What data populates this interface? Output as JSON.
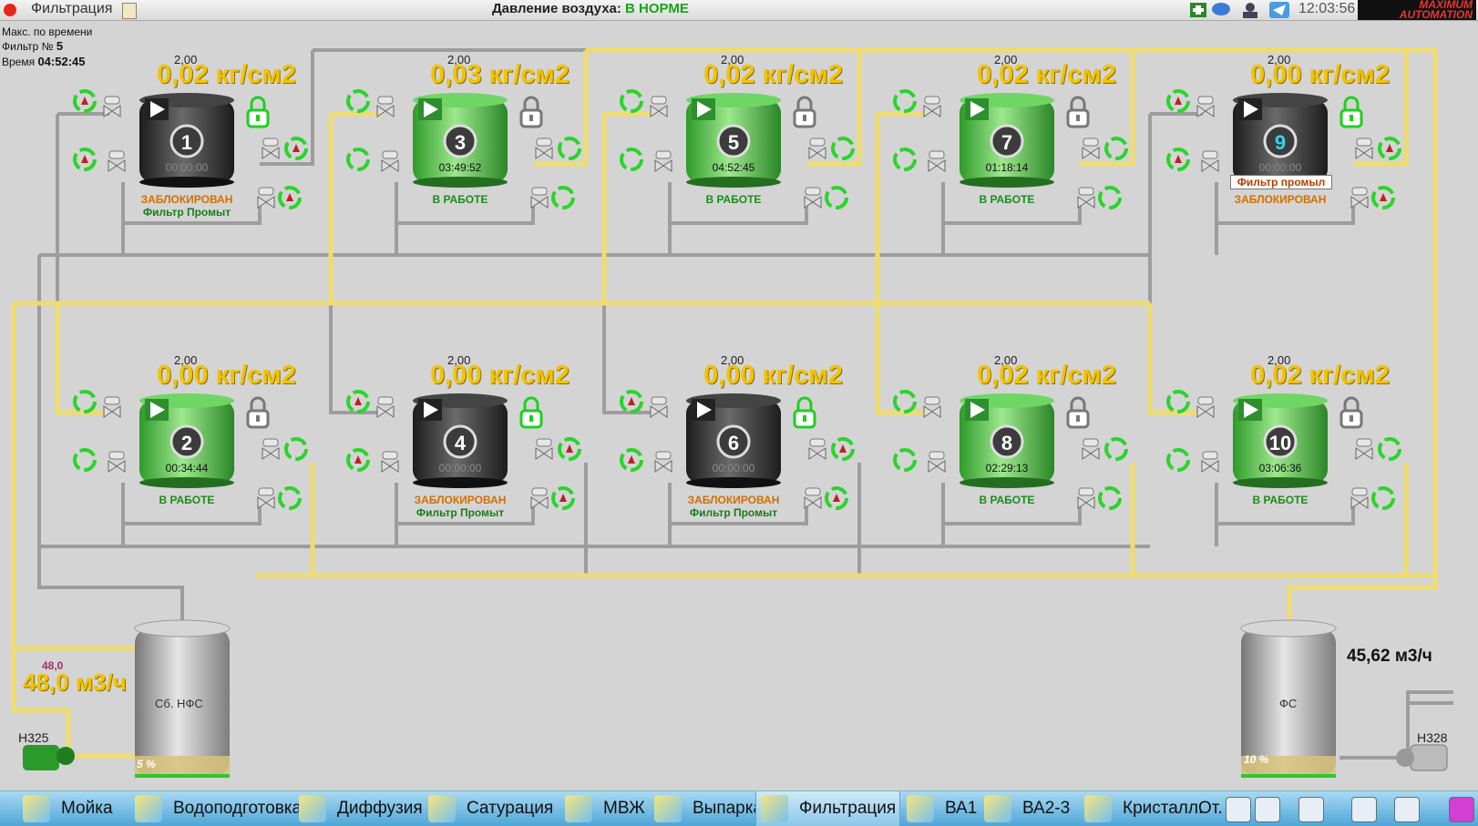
{
  "window": {
    "title": "Фильтрация",
    "air_label": "Давление воздуха:",
    "air_status": "В НОРМЕ",
    "clock": "12:03:56",
    "brand": "MAXIMUM AUTOMATION"
  },
  "info": {
    "mode": "Макс. по времени",
    "filter_label": "Фильтр №",
    "filter_no": "5",
    "time_label": "Время",
    "time": "04:52:45"
  },
  "filters": [
    {
      "id": "1",
      "set": "2,00",
      "pressure": "0,02 кг/см2",
      "timer": "00:00:00",
      "status": "ЗАБЛОКИРОВАН",
      "sub": "Фильтр Промыт",
      "state": "blocked"
    },
    {
      "id": "3",
      "set": "2,00",
      "pressure": "0,03 кг/см2",
      "timer": "03:49:52",
      "status": "В РАБОТЕ",
      "sub": "",
      "state": "work"
    },
    {
      "id": "5",
      "set": "2,00",
      "pressure": "0,02 кг/см2",
      "timer": "04:52:45",
      "status": "В РАБОТЕ",
      "sub": "",
      "state": "work"
    },
    {
      "id": "7",
      "set": "2,00",
      "pressure": "0,02 кг/см2",
      "timer": "01:18:14",
      "status": "В РАБОТЕ",
      "sub": "",
      "state": "work"
    },
    {
      "id": "9",
      "set": "2,00",
      "pressure": "0,00 кг/см2",
      "timer": "00:00:00",
      "status": "ЗАБЛОКИРОВАН",
      "sub": "Фильтр промыл",
      "state": "blocked"
    },
    {
      "id": "2",
      "set": "2,00",
      "pressure": "0,00 кг/см2",
      "timer": "00:34:44",
      "status": "В РАБОТЕ",
      "sub": "",
      "state": "work"
    },
    {
      "id": "4",
      "set": "2,00",
      "pressure": "0,00 кг/см2",
      "timer": "00:00:00",
      "status": "ЗАБЛОКИРОВАН",
      "sub": "Фильтр Промыт",
      "state": "blocked"
    },
    {
      "id": "6",
      "set": "2,00",
      "pressure": "0,00 кг/см2",
      "timer": "00:00:00",
      "status": "ЗАБЛОКИРОВАН",
      "sub": "Фильтр Промыт",
      "state": "blocked"
    },
    {
      "id": "8",
      "set": "2,00",
      "pressure": "0,02 кг/см2",
      "timer": "02:29:13",
      "status": "В РАБОТЕ",
      "sub": "",
      "state": "work"
    },
    {
      "id": "10",
      "set": "2,00",
      "pressure": "0,02 кг/см2",
      "timer": "03:06:36",
      "status": "В РАБОТЕ",
      "sub": "",
      "state": "work"
    }
  ],
  "left_tank": {
    "label": "Сб. НФС",
    "level": "5 %",
    "flow_set": "48,0",
    "flow": "48,0 м3/ч",
    "pump": "Н325"
  },
  "right_tank": {
    "label": "ФС",
    "level": "10 %",
    "flow": "45,62 м3/ч",
    "pump": "Н328"
  },
  "taskbar": [
    "Мойка",
    "Водоподготовка",
    "Диффузия",
    "Сатурация",
    "МВЖ",
    "Выпарка",
    "Фильтрация",
    "ВА1",
    "ВА2-3",
    "Кристалл.",
    "От."
  ],
  "taskbar_active": "Фильтрация",
  "colors": {
    "pipe_yellow": "#f0df73",
    "pipe_gray": "#a8a8a8",
    "tank_green": "#5fcf55",
    "tank_dark": "#333333",
    "pressure": "#f2c300"
  }
}
